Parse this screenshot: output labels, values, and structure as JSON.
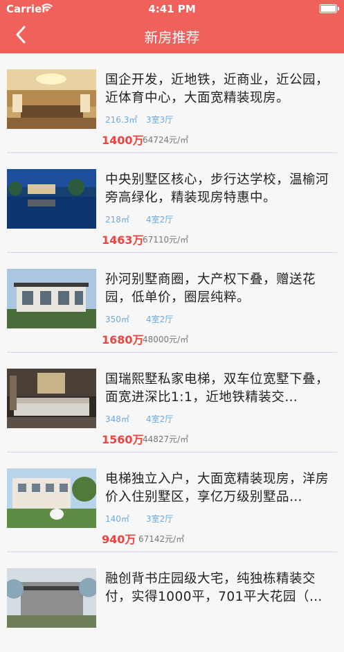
{
  "status_bar": {
    "carrier": "Carrier",
    "time": "4:41 PM"
  },
  "nav": {
    "title": "新房推荐"
  },
  "listings": [
    {
      "title": "国企开发，近地铁，近商业，近公园，近体育中心，大面宽精装现房。",
      "area": "216.3㎡",
      "rooms": "3室3厅",
      "price": "1400万",
      "unit_price": "64724元/㎡"
    },
    {
      "title": "中央别墅区核心，步行达学校，温榆河旁高绿化，精装现房特惠中。",
      "area": "218㎡",
      "rooms": "4室2厅",
      "price": "1463万",
      "unit_price": "67110元/㎡"
    },
    {
      "title": "孙河别墅商圈，大产权下叠，赠送花园，低单价，圈层纯粹。",
      "area": "350㎡",
      "rooms": "4室2厅",
      "price": "1680万",
      "unit_price": "48000元/㎡"
    },
    {
      "title": "国瑞熙墅私家电梯，双车位宽墅下叠，面宽进深比1:1，近地铁精装交…",
      "area": "348㎡",
      "rooms": "4室2厅",
      "price": "1560万",
      "unit_price": "44827元/㎡"
    },
    {
      "title": "电梯独立入户，大面宽精装现房，洋房价入住别墅区，享亿万级别墅品…",
      "area": "140㎡",
      "rooms": "3室2厅",
      "price": "940万",
      "unit_price": "67142元/㎡"
    },
    {
      "title": "融创背书庄园级大宅，纯独栋精装交付，实得1000平，701平大花园（…",
      "area": "",
      "rooms": "",
      "price": "",
      "unit_price": ""
    }
  ]
}
